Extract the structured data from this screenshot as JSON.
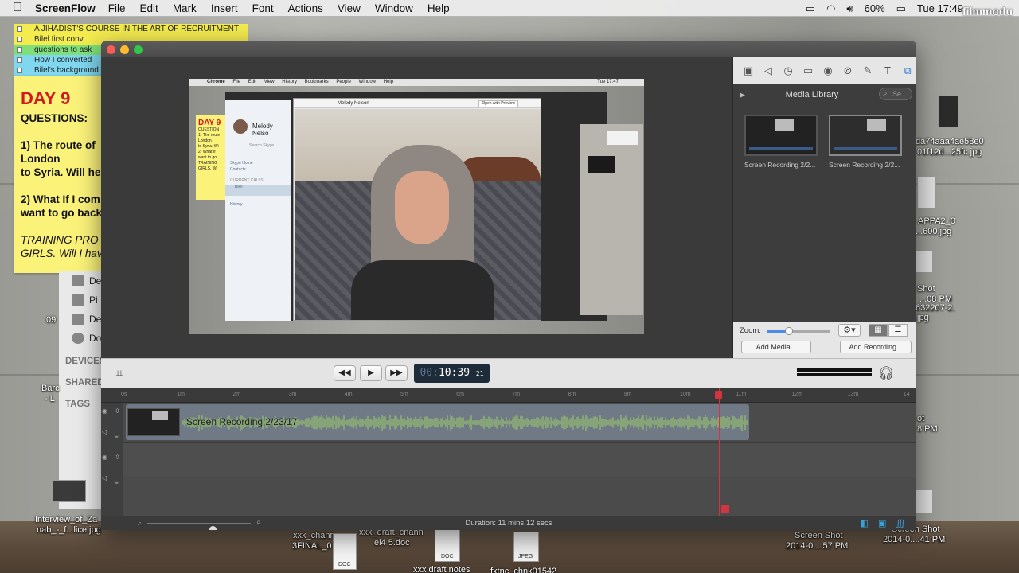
{
  "menubar": {
    "app_name": "ScreenFlow",
    "items": [
      "File",
      "Edit",
      "Mark",
      "Insert",
      "Font",
      "Actions",
      "View",
      "Window",
      "Help"
    ],
    "battery": "60%",
    "clock": "Tue 17:49",
    "watermark": "filmmodu"
  },
  "sticky": {
    "tabs": [
      "A JIHADIST'S COURSE IN THE ART OF RECRUITMENT",
      "Bilel first conv",
      "questions to ask",
      "How I converted",
      "Bilel's background"
    ],
    "tab_colors": [
      "#f4ec4f",
      "#f4ec4f",
      "#7fe07a",
      "#7fd8f0",
      "#7fd8f0"
    ],
    "day": "DAY 9",
    "lines": [
      "QUESTIONS:",
      "",
      "1) The route of",
      "London",
      "to Syria. Will he",
      "",
      "2) What If I com",
      "want to go back",
      "",
      "TRAINING PRO",
      "GIRLS. Will I hav"
    ]
  },
  "finder": {
    "items": [
      "De",
      "Pi",
      "De",
      "Do"
    ],
    "sections": [
      "DEVICES",
      "SHARED",
      "TAGS"
    ]
  },
  "desktop_icons": {
    "right": [
      "da74aaa4ae58e0",
      "01f12d...25fc.jpg",
      "APPA2_0",
      "...600.jpg",
      "Shot",
      "...08 PM",
      "632207-2.",
      "jpg",
      "ot",
      "8 PM"
    ],
    "left": [
      "09",
      "Barc",
      "- L",
      "Interview_of_Za",
      "nab_-_f...lice.jpg"
    ],
    "bottom": [
      "xxx_chann",
      "3FINAL_0",
      "xxx_draft_chann",
      "el4 5.doc",
      "xxx draft notes",
      "fxtnc_chnk01542",
      "Screen Shot",
      "2014-0....57 PM",
      "Screen Shot",
      "2014-0....41 PM"
    ],
    "bottom_badges": [
      "DOC",
      "DOC",
      "JPEG"
    ]
  },
  "preview": {
    "menubar": [
      "Chrome",
      "File",
      "Edit",
      "View",
      "History",
      "Bookmarks",
      "People",
      "Window",
      "Help"
    ],
    "clock": "Tue 17:47",
    "sticky_day": "DAY 9",
    "sticky_lines": [
      "QUESTION",
      "1) The route",
      "London",
      "to Syria. Wi",
      "2) What If I",
      "want to go",
      "TRAINING",
      "GIRLS. Wi"
    ],
    "skype_name": "Melody Nelso",
    "skype_items": [
      "Skype Home",
      "Contacts",
      "CURRENT CALLS",
      "Bilel",
      "History"
    ],
    "skype_search": "Search Skype",
    "call_title": "Melody Nelson",
    "open_with_preview": "Open with Preview"
  },
  "inspector": {
    "toolbar_icons": [
      "video-properties-icon",
      "audio-properties-icon",
      "screen-recording-icon",
      "callout-icon",
      "touch-callout-icon",
      "annotations-icon",
      "pen-icon",
      "text-icon",
      "media-library-icon"
    ],
    "media_library_title": "Media Library",
    "search_placeholder": "Se",
    "media_items": [
      "Screen Recording 2/2...",
      "Screen Recording 2/2..."
    ],
    "zoom_label": "Zoom:",
    "zoom_level": 0.35,
    "add_media": "Add Media...",
    "add_recording": "Add Recording..."
  },
  "transport": {
    "timecode_dim": "00:",
    "timecode_main": "10:39",
    "timecode_frames": "21"
  },
  "timeline": {
    "ruler": [
      "0s",
      "1m",
      "2m",
      "3m",
      "4m",
      "5m",
      "6m",
      "7m",
      "8m",
      "9m",
      "10m",
      "11m",
      "12m",
      "13m",
      "14"
    ],
    "clip_label": "Screen Recording 2/23/17",
    "duration": "Duration: 11 mins 12 secs",
    "accent_color": "#d23440"
  }
}
